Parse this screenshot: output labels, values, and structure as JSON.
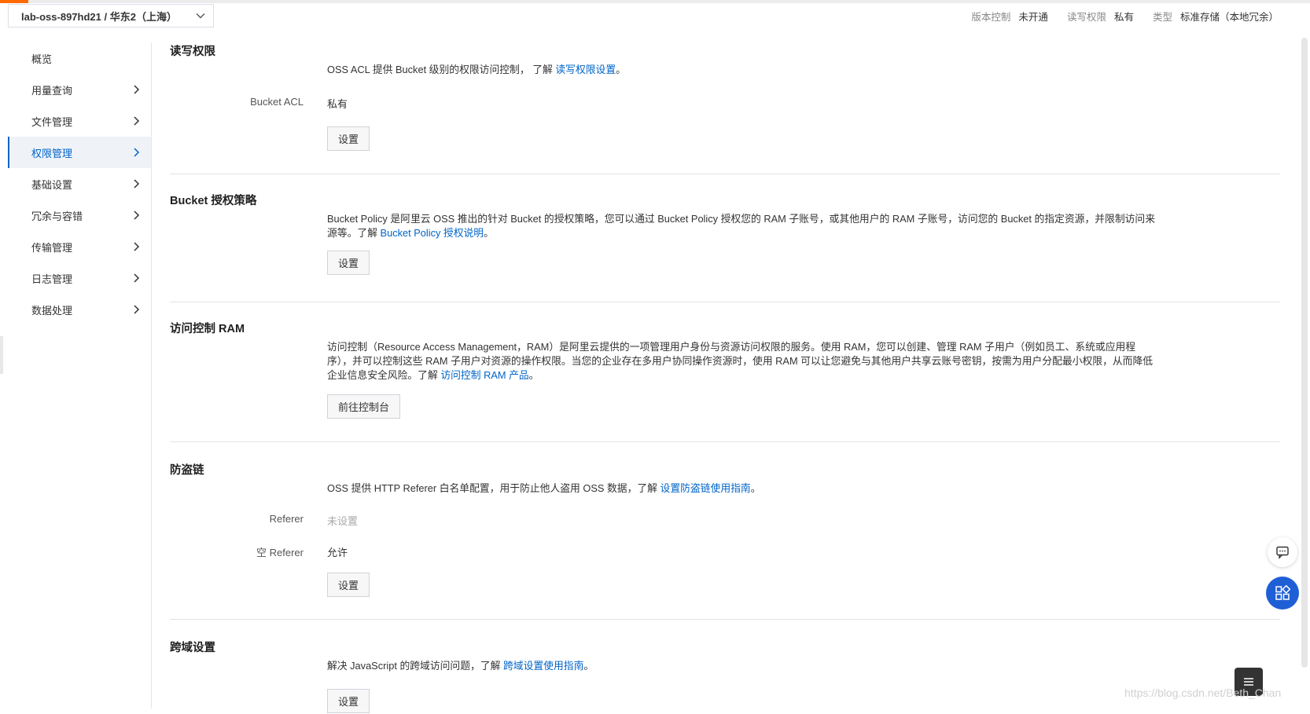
{
  "bucket_selector": {
    "label": "lab-oss-897hd21 / 华东2（上海）"
  },
  "meta": [
    {
      "key": "版本控制",
      "value": "未开通"
    },
    {
      "key": "读写权限",
      "value": "私有"
    },
    {
      "key": "类型",
      "value": "标准存储（本地冗余）"
    }
  ],
  "sidebar": {
    "items": [
      {
        "label": "概览"
      },
      {
        "label": "用量查询"
      },
      {
        "label": "文件管理"
      },
      {
        "label": "权限管理"
      },
      {
        "label": "基础设置"
      },
      {
        "label": "冗余与容错"
      },
      {
        "label": "传输管理"
      },
      {
        "label": "日志管理"
      },
      {
        "label": "数据处理"
      }
    ],
    "active": "权限管理"
  },
  "sections": {
    "acl": {
      "title": "读写权限",
      "desc": "OSS ACL 提供 Bucket 级别的权限访问控制， 了解 ",
      "link": "读写权限设置",
      "desc_end": "。",
      "row_label": "Bucket ACL",
      "row_value": "私有",
      "button": "设置"
    },
    "policy": {
      "title": "Bucket 授权策略",
      "desc": "Bucket Policy 是阿里云 OSS 推出的针对 Bucket 的授权策略，您可以通过 Bucket Policy 授权您的 RAM 子账号，或其他用户的 RAM 子账号，访问您的 Bucket 的指定资源，并限制访问来源等。了解 ",
      "link": "Bucket Policy 授权说明",
      "desc_end": "。",
      "button": "设置"
    },
    "ram": {
      "title": "访问控制 RAM",
      "desc": "访问控制（Resource Access Management，RAM）是阿里云提供的一项管理用户身份与资源访问权限的服务。使用 RAM，您可以创建、管理 RAM 子用户（例如员工、系统或应用程序），并可以控制这些 RAM 子用户对资源的操作权限。当您的企业存在多用户协同操作资源时，使用 RAM 可以让您避免与其他用户共享云账号密钥，按需为用户分配最小权限，从而降低企业信息安全风险。了解 ",
      "link": "访问控制 RAM 产品",
      "desc_end": "。",
      "button": "前往控制台"
    },
    "referer": {
      "title": "防盗链",
      "desc": "OSS 提供 HTTP Referer 白名单配置，用于防止他人盗用 OSS 数据，了解 ",
      "link": "设置防盗链使用指南",
      "desc_end": "。",
      "row1_label": "Referer",
      "row1_value": "未设置",
      "row2_label": "空 Referer",
      "row2_value": "允许",
      "button": "设置"
    },
    "cors": {
      "title": "跨域设置",
      "desc": "解决 JavaScript 的跨域访问问题，了解 ",
      "link": "跨域设置使用指南",
      "desc_end": "。",
      "button": "设置"
    }
  },
  "watermark": "https://blog.csdn.net/Beth_Chan",
  "colors": {
    "accent": "#0064c8",
    "brand": "#ff6a00",
    "fab": "#1f5fd6"
  }
}
